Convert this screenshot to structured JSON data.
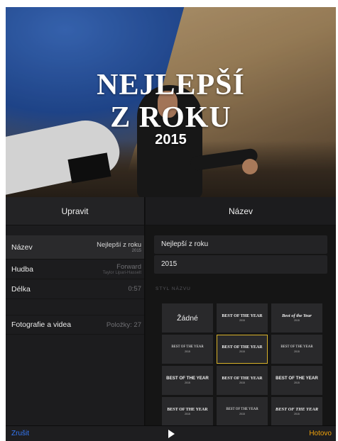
{
  "hero": {
    "title_line1": "NEJLEPŠÍ",
    "title_line2": "Z ROKU",
    "year": "2015"
  },
  "left_panel": {
    "header": "Upravit",
    "rows": [
      {
        "label": "Název",
        "value": "Nejlepší z roku",
        "sub": "2015"
      },
      {
        "label": "Hudba",
        "value": "Forward",
        "sub": "Taylor Lipari-Hasselt"
      },
      {
        "label": "Délka",
        "value": "0:57"
      }
    ],
    "media": {
      "label": "Fotografie a videa",
      "value": "Položky: 27"
    }
  },
  "right_panel": {
    "header": "Název",
    "title_field": "Nejlepší z roku",
    "subtitle_field": "2015",
    "section_label": "STYL NÁZVU",
    "styles": [
      {
        "main": "Žádné",
        "year": ""
      },
      {
        "main": "BEST OF THE YEAR",
        "year": "2015"
      },
      {
        "main": "Best of the Year",
        "year": "2015"
      },
      {
        "main": "BEST OF THE YEAR",
        "year": "2015"
      },
      {
        "main": "BEST OF THE YEAR",
        "year": "2015"
      },
      {
        "main": "BEST OF THE YEAR",
        "year": "2015"
      },
      {
        "main": "BEST OF THE YEAR",
        "year": "2015"
      },
      {
        "main": "BEST OF THE YEAR",
        "year": "2015"
      },
      {
        "main": "BEST OF THE YEAR",
        "year": "2015"
      },
      {
        "main": "BEST OF THE YEAR",
        "year": "2015"
      },
      {
        "main": "BEST OF THE YEAR",
        "year": "2015"
      },
      {
        "main": "BEST OF THE YEAR",
        "year": "2015"
      }
    ]
  },
  "bottom_bar": {
    "cancel": "Zrušit",
    "done": "Hotovo"
  },
  "colors": {
    "accent_blue": "#3478f6",
    "accent_orange": "#f0a20b",
    "selection_gold": "#d8b22a"
  }
}
